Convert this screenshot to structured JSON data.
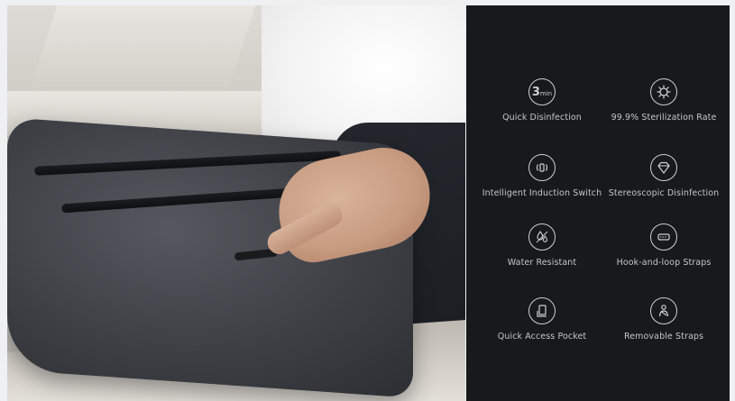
{
  "features": [
    {
      "icon": "three-min-timer-icon",
      "icon_text": "3",
      "icon_sub": "min",
      "label": "Quick Disinfection"
    },
    {
      "icon": "virus-icon",
      "label": "99.9% Sterilization Rate"
    },
    {
      "icon": "induction-switch-icon",
      "label": "Intelligent Induction Switch"
    },
    {
      "icon": "stereoscopic-diamond-icon",
      "label": "Stereoscopic Disinfection"
    },
    {
      "icon": "water-drops-icon",
      "label": "Water Resistant"
    },
    {
      "icon": "hook-loop-strap-icon",
      "label": "Hook-and-loop Straps"
    },
    {
      "icon": "phone-pocket-icon",
      "label": "Quick Access Pocket"
    },
    {
      "icon": "person-strap-icon",
      "label": "Removable Straps"
    }
  ],
  "colors": {
    "panel_background": "#18191b",
    "icon_stroke": "#cfd0d2",
    "label_text": "#c5c6c8"
  }
}
